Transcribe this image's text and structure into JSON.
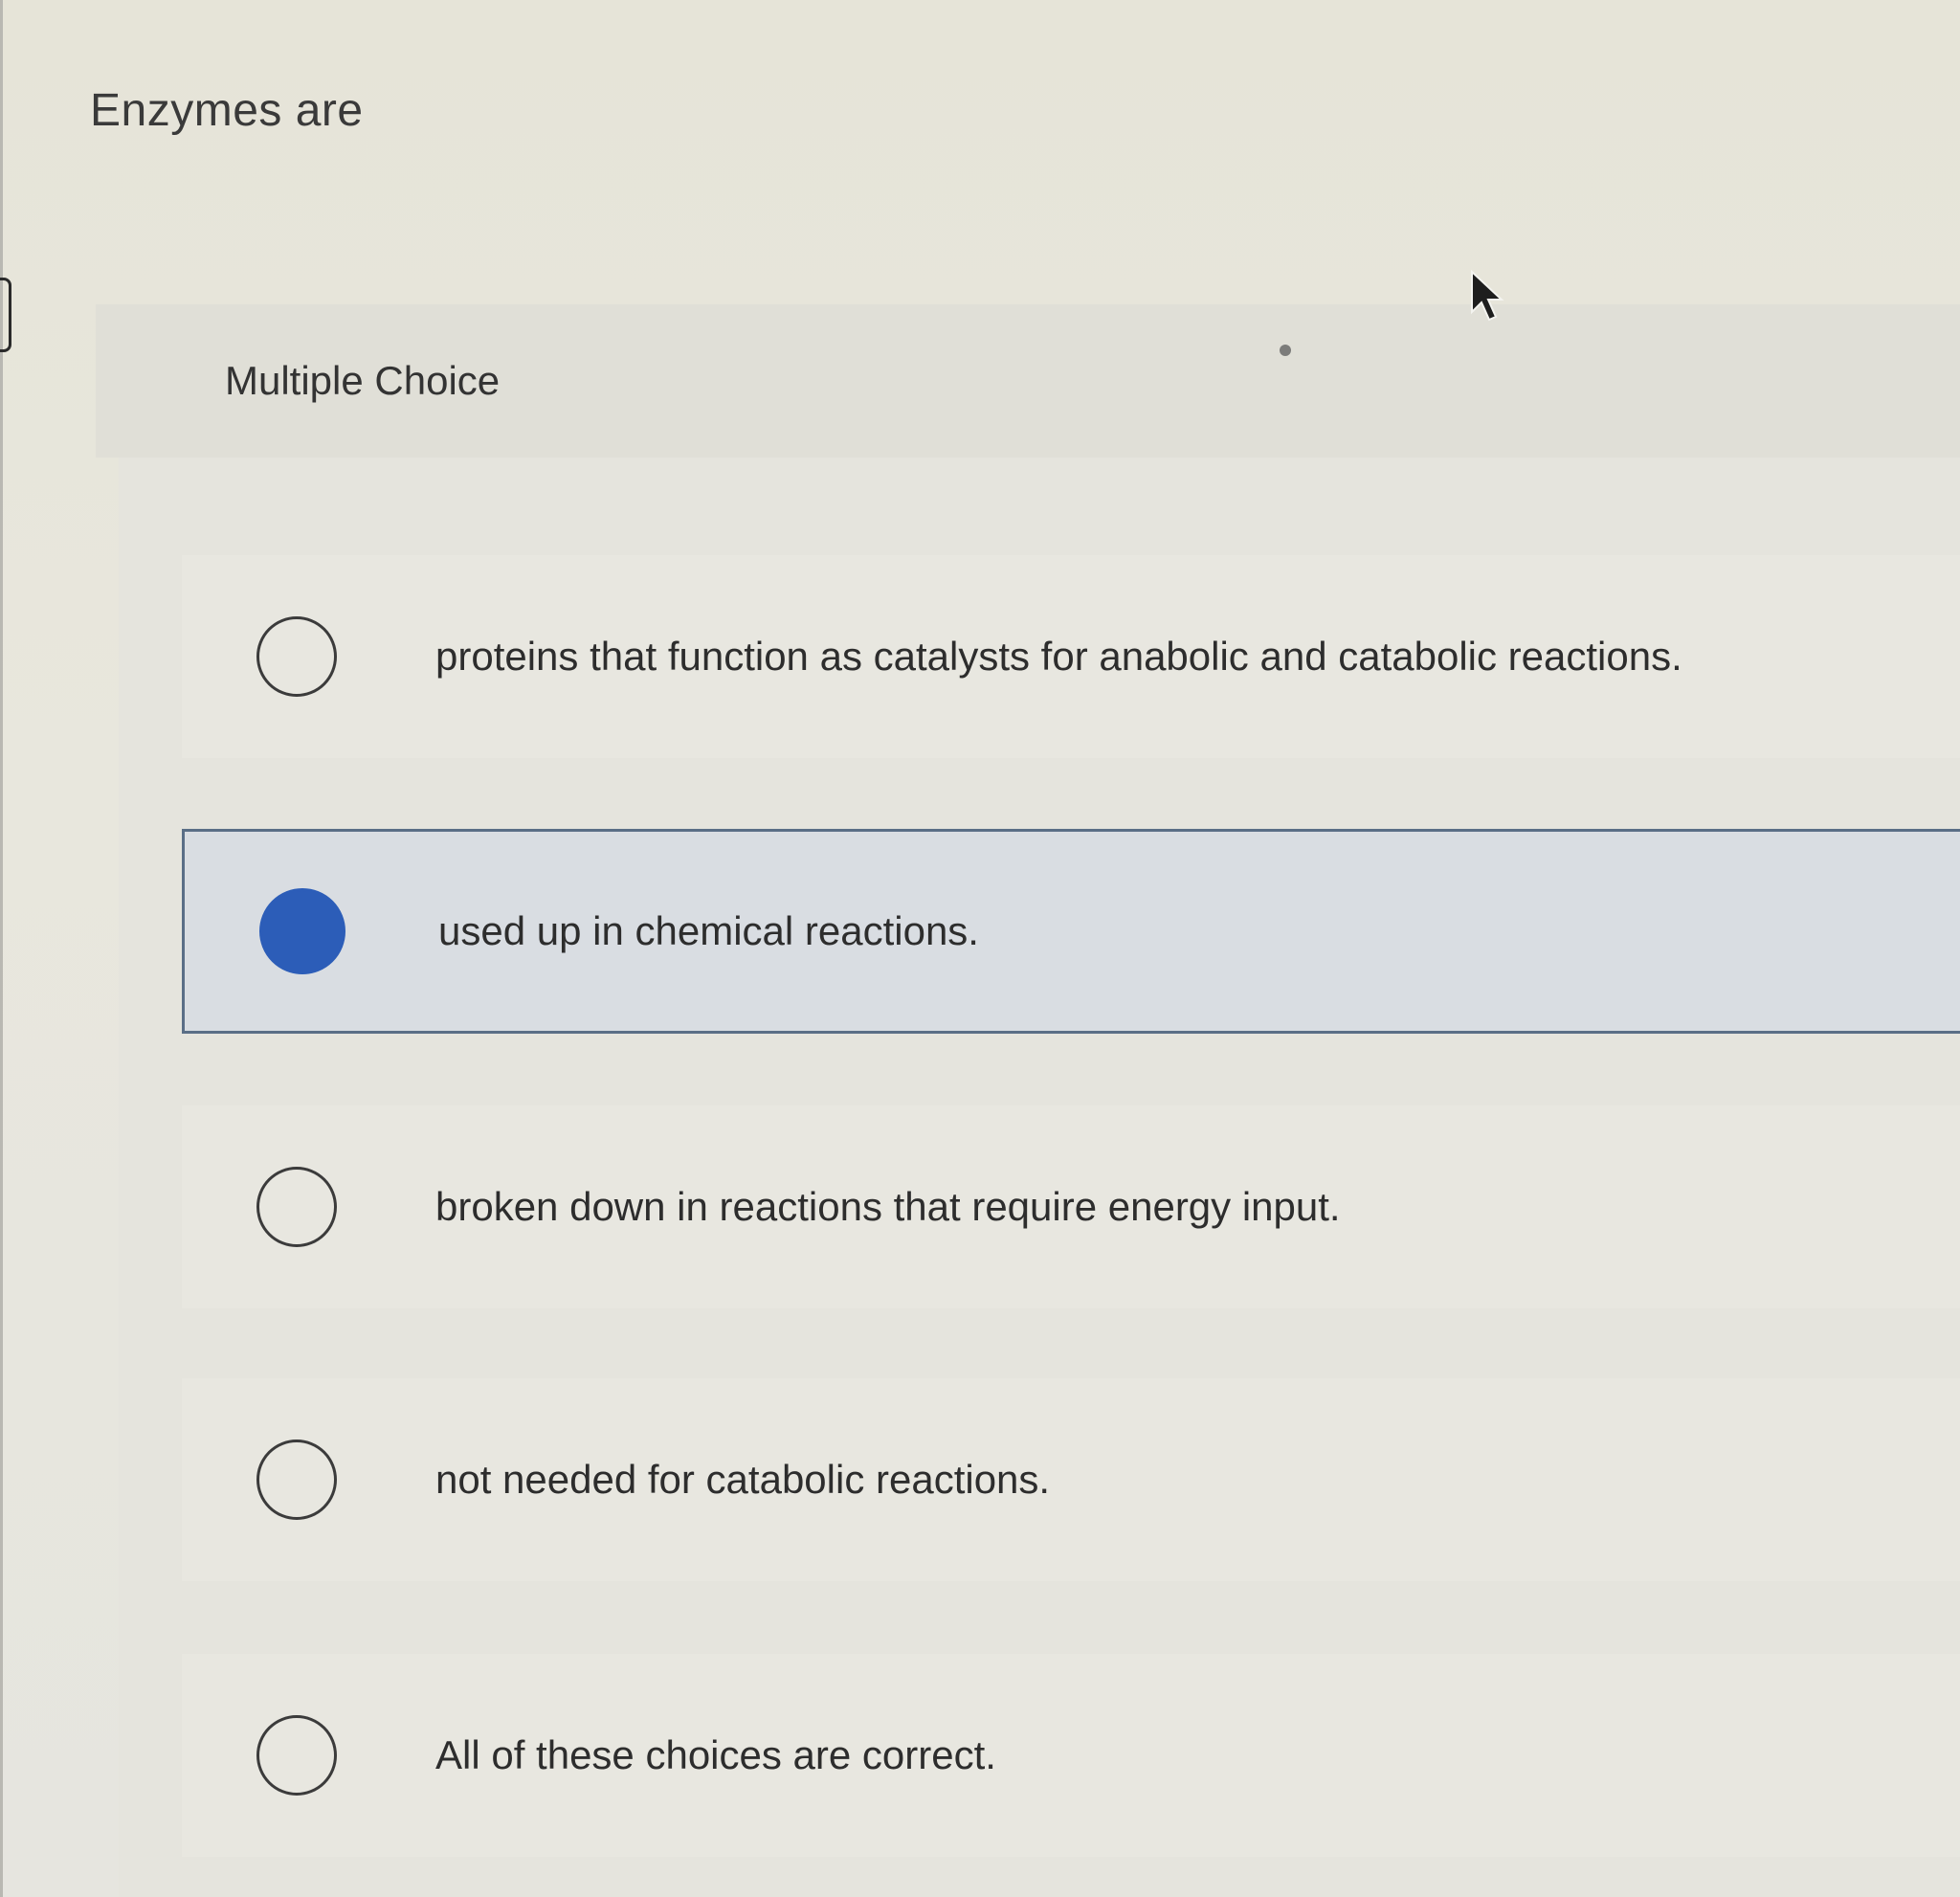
{
  "question": {
    "title": "Enzymes are"
  },
  "section": {
    "label": "Multiple Choice"
  },
  "choices": [
    {
      "text": "proteins that function as catalysts for anabolic and catabolic reactions.",
      "selected": false
    },
    {
      "text": "used up in chemical reactions.",
      "selected": true
    },
    {
      "text": "broken down in reactions that require energy input.",
      "selected": false
    },
    {
      "text": "not needed for catabolic reactions.",
      "selected": false
    },
    {
      "text": "All of these choices are correct.",
      "selected": false
    }
  ],
  "colors": {
    "selected_fill": "#2c5db8",
    "selected_border": "#5a6e86",
    "selected_background": "#d9dde2"
  },
  "icons": {
    "cursor": "mouse-pointer-icon",
    "radio_empty": "radio-unselected-icon",
    "radio_filled": "radio-selected-icon"
  }
}
